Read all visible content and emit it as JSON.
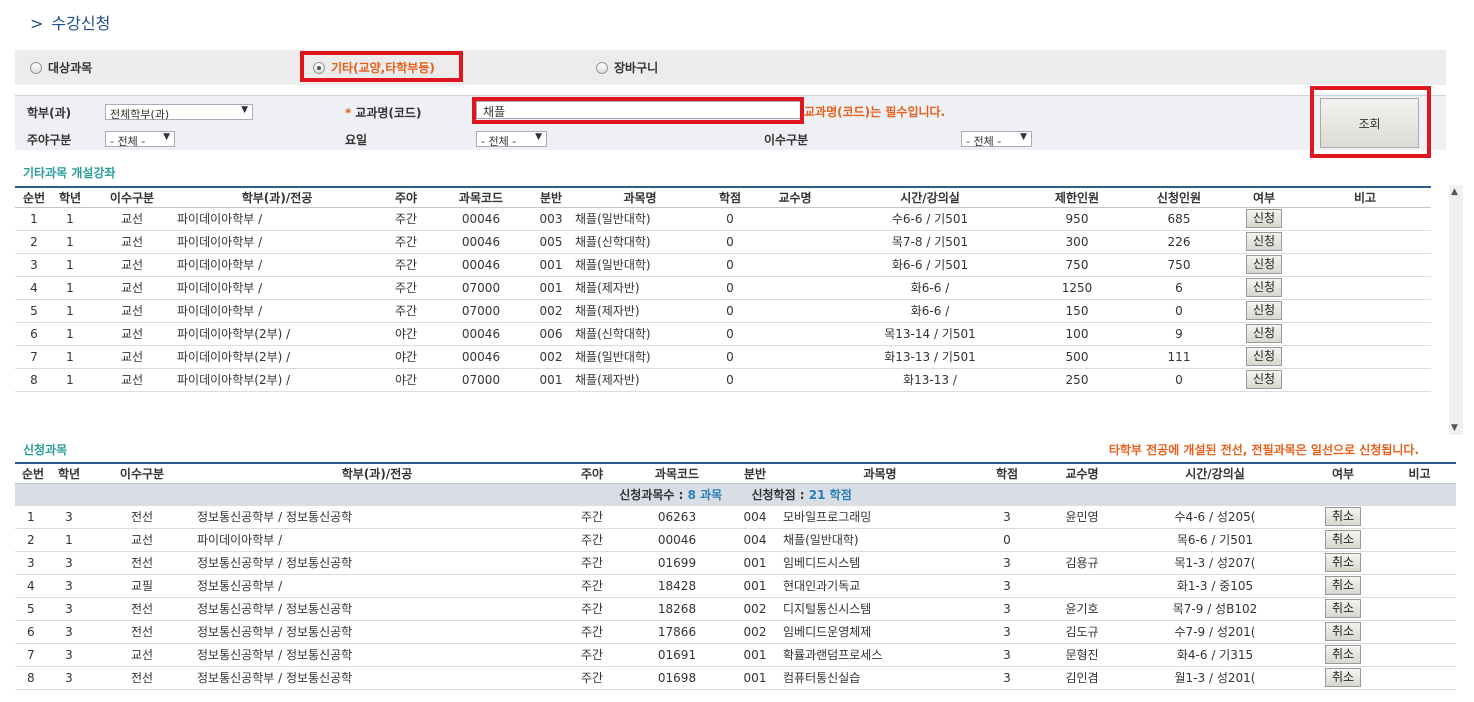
{
  "page": {
    "title": "수강신청"
  },
  "tabs": [
    {
      "label": "대상과목",
      "selected": false
    },
    {
      "label": "기타(교양,타학부등)",
      "selected": true
    },
    {
      "label": "장바구니",
      "selected": false
    }
  ],
  "filters": {
    "dept_label": "학부(과)",
    "dept_value": "전체학부(과)",
    "course_label": "교과명(코드)",
    "course_required_mark": "*",
    "course_value": "채플",
    "required_msg": "교과명(코드)는 필수입니다.",
    "daynight_label": "주야구분",
    "daynight_value": "- 전체 -",
    "weekday_label": "요일",
    "weekday_value": "- 전체 -",
    "category_label": "이수구분",
    "category_value": "- 전체 -",
    "search_button": "조회"
  },
  "offered": {
    "section_title": "기타과목 개설강좌",
    "headers": [
      "순번",
      "학년",
      "이수구분",
      "학부(과)/전공",
      "주야",
      "과목코드",
      "분반",
      "과목명",
      "학점",
      "교수명",
      "시간/강의실",
      "제한인원",
      "신청인원",
      "여부",
      "비고"
    ],
    "apply_label": "신청",
    "rows": [
      [
        "1",
        "1",
        "교선",
        "파이데이아학부 /",
        "주간",
        "00046",
        "003",
        "채플(일반대학)",
        "0",
        "",
        "수6-6 / 기501",
        "950",
        "685"
      ],
      [
        "2",
        "1",
        "교선",
        "파이데이아학부 /",
        "주간",
        "00046",
        "005",
        "채플(신학대학)",
        "0",
        "",
        "목7-8 / 기501",
        "300",
        "226"
      ],
      [
        "3",
        "1",
        "교선",
        "파이데이아학부 /",
        "주간",
        "00046",
        "001",
        "채플(일반대학)",
        "0",
        "",
        "화6-6 / 기501",
        "750",
        "750"
      ],
      [
        "4",
        "1",
        "교선",
        "파이데이아학부 /",
        "주간",
        "07000",
        "001",
        "채플(제자반)",
        "0",
        "",
        "화6-6 /",
        "1250",
        "6"
      ],
      [
        "5",
        "1",
        "교선",
        "파이데이아학부 /",
        "주간",
        "07000",
        "002",
        "채플(제자반)",
        "0",
        "",
        "화6-6 /",
        "150",
        "0"
      ],
      [
        "6",
        "1",
        "교선",
        "파이데이아학부(2부) /",
        "야간",
        "00046",
        "006",
        "채플(신학대학)",
        "0",
        "",
        "목13-14 / 기501",
        "100",
        "9"
      ],
      [
        "7",
        "1",
        "교선",
        "파이데이아학부(2부) /",
        "야간",
        "00046",
        "002",
        "채플(일반대학)",
        "0",
        "",
        "화13-13 / 기501",
        "500",
        "111"
      ],
      [
        "8",
        "1",
        "교선",
        "파이데이아학부(2부) /",
        "야간",
        "07000",
        "001",
        "채플(제자반)",
        "0",
        "",
        "화13-13 /",
        "250",
        "0"
      ]
    ]
  },
  "registered": {
    "section_title": "신청과목",
    "notice": "타학부 전공에 개설된 전선, 전필과목은 일선으로 신청됩니다.",
    "headers": [
      "순번",
      "학년",
      "이수구분",
      "학부(과)/전공",
      "주야",
      "과목코드",
      "분반",
      "과목명",
      "학점",
      "교수명",
      "시간/강의실",
      "여부",
      "비고"
    ],
    "summary_count_label": "신청과목수 :",
    "summary_count_value": "8 과목",
    "summary_credit_label": "신청학점 :",
    "summary_credit_value": "21 학점",
    "cancel_label": "취소",
    "rows": [
      [
        "1",
        "3",
        "전선",
        "정보통신공학부 / 정보통신공학",
        "주간",
        "06263",
        "004",
        "모바일프로그래밍",
        "3",
        "윤민영",
        "수4-6 / 성205("
      ],
      [
        "2",
        "1",
        "교선",
        "파이데이아학부 /",
        "주간",
        "00046",
        "004",
        "채플(일반대학)",
        "0",
        "",
        "목6-6 / 기501"
      ],
      [
        "3",
        "3",
        "전선",
        "정보통신공학부 / 정보통신공학",
        "주간",
        "01699",
        "001",
        "임베디드시스템",
        "3",
        "김용규",
        "목1-3 / 성207("
      ],
      [
        "4",
        "3",
        "교필",
        "정보통신공학부 /",
        "주간",
        "18428",
        "001",
        "현대인과기독교",
        "3",
        "",
        "화1-3 / 중105"
      ],
      [
        "5",
        "3",
        "전선",
        "정보통신공학부 / 정보통신공학",
        "주간",
        "18268",
        "002",
        "디지털통신시스템",
        "3",
        "윤기호",
        "목7-9 / 성B102"
      ],
      [
        "6",
        "3",
        "전선",
        "정보통신공학부 / 정보통신공학",
        "주간",
        "17866",
        "002",
        "임베디드운영체제",
        "3",
        "김도규",
        "수7-9 / 성201("
      ],
      [
        "7",
        "3",
        "교선",
        "정보통신공학부 / 정보통신공학",
        "주간",
        "01691",
        "001",
        "확률과랜덤프로세스",
        "3",
        "문형진",
        "화4-6 / 기315"
      ],
      [
        "8",
        "3",
        "전선",
        "정보통신공학부 / 정보통신공학",
        "주간",
        "01698",
        "001",
        "컴퓨터통신실습",
        "3",
        "김인겸",
        "월1-3 / 성201("
      ]
    ]
  }
}
